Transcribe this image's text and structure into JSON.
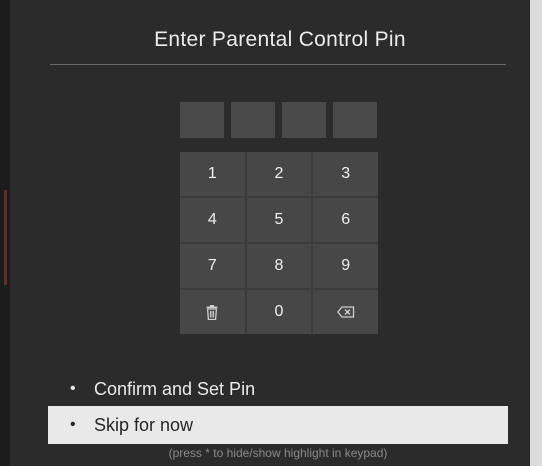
{
  "dialog": {
    "title": "Enter Parental Control Pin"
  },
  "pin": {
    "digits": [
      "",
      "",
      "",
      ""
    ]
  },
  "keypad": {
    "keys": [
      {
        "label": "1",
        "icon": null
      },
      {
        "label": "2",
        "icon": null
      },
      {
        "label": "3",
        "icon": null
      },
      {
        "label": "4",
        "icon": null
      },
      {
        "label": "5",
        "icon": null
      },
      {
        "label": "6",
        "icon": null
      },
      {
        "label": "7",
        "icon": null
      },
      {
        "label": "8",
        "icon": null
      },
      {
        "label": "9",
        "icon": null
      },
      {
        "label": "",
        "icon": "trash-icon"
      },
      {
        "label": "0",
        "icon": null
      },
      {
        "label": "",
        "icon": "backspace-icon"
      }
    ]
  },
  "menu": {
    "items": [
      {
        "bullet": "•",
        "label": "Confirm and Set Pin",
        "selected": false
      },
      {
        "bullet": "•",
        "label": "Skip for now",
        "selected": true
      }
    ]
  },
  "hint": {
    "text": "(press * to hide/show highlight in keypad)"
  },
  "colors": {
    "background": "#2b2b2b",
    "key": "#474747",
    "selected_row": "#e9e9e9"
  }
}
